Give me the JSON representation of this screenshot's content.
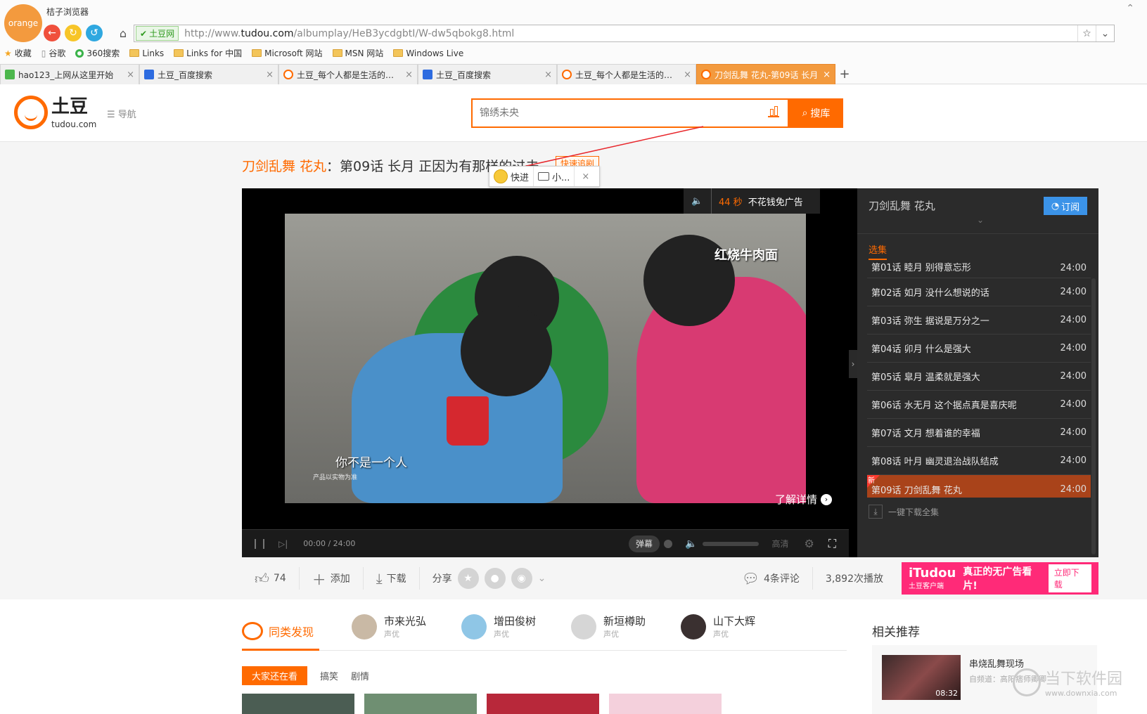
{
  "browser": {
    "logo_text": "orange",
    "app_name": "桔子浏览器",
    "address": {
      "site_badge": "土豆网",
      "url_prefix": "http://www.",
      "url_domain": "tudou.com",
      "url_path": "/albumplay/HeB3ycdgbtI/W-dw5qbokg8.html"
    },
    "bookmarks": [
      {
        "label": "收藏",
        "icon": "star-icon"
      },
      {
        "label": "谷歌",
        "icon": "page-icon"
      },
      {
        "label": "360搜索",
        "icon": "360-icon"
      },
      {
        "label": "Links",
        "icon": "folder-icon"
      },
      {
        "label": "Links for 中国",
        "icon": "folder-icon"
      },
      {
        "label": "Microsoft 网站",
        "icon": "folder-icon"
      },
      {
        "label": "MSN 网站",
        "icon": "folder-icon"
      },
      {
        "label": "Windows Live",
        "icon": "folder-icon"
      }
    ],
    "tabs": [
      {
        "label": "hao123_上网从这里开始",
        "icon": "hao123-icon"
      },
      {
        "label": "土豆_百度搜索",
        "icon": "baidu-icon"
      },
      {
        "label": "土豆_每个人都是生活的导演",
        "icon": "tudou-icon"
      },
      {
        "label": "土豆_百度搜索",
        "icon": "baidu-icon"
      },
      {
        "label": "土豆_每个人都是生活的导演",
        "icon": "tudou-icon"
      },
      {
        "label": "刀剑乱舞 花丸-第09话 长月",
        "icon": "tudou-icon",
        "active": true
      }
    ]
  },
  "site": {
    "brand": "土豆",
    "domain": "tudou.com",
    "nav_label": "导航",
    "search_placeholder": "锦绣未央",
    "search_button": "搜库"
  },
  "video": {
    "title_show": "刀剑乱舞 花丸",
    "title_rest": "：第09话 长月 正因为有那样的过去",
    "quick_tag": "快速追剧",
    "float_toolbar": {
      "fast": "快进",
      "mini": "小..."
    },
    "ad": {
      "seconds": "44 秒",
      "text": "不花钱免广告"
    },
    "frame_brand": "红烧牛肉面",
    "subtitle": "你不是一个人",
    "subnote": "产品以实物为准",
    "learn_more": "了解详情",
    "controls": {
      "time": "00:00 / 24:00",
      "danmu": "弹幕",
      "quality": "高清"
    }
  },
  "episodes": {
    "show": "刀剑乱舞 花丸",
    "subscribe": "订阅",
    "tab": "选集",
    "items": [
      {
        "label": "第01话 睦月 别得意忘形",
        "duration": "24:00"
      },
      {
        "label": "第02话 如月 没什么想说的话",
        "duration": "24:00"
      },
      {
        "label": "第03话 弥生 据说是万分之一",
        "duration": "24:00"
      },
      {
        "label": "第04话 卯月 什么是强大",
        "duration": "24:00"
      },
      {
        "label": "第05话 皐月 温柔就是强大",
        "duration": "24:00"
      },
      {
        "label": "第06话 水无月 这个据点真是喜庆呢",
        "duration": "24:00"
      },
      {
        "label": "第07话 文月 想着谁的幸福",
        "duration": "24:00"
      },
      {
        "label": "第08话 叶月 幽灵退治战队结成",
        "duration": "24:00"
      },
      {
        "label": "第09话 刀剑乱舞 花丸",
        "duration": "24:00",
        "current": true,
        "badge": "新"
      }
    ],
    "download_all": "一键下载全集"
  },
  "actions": {
    "likes": "74",
    "add": "添加",
    "download": "下载",
    "share": "分享",
    "comments": "4条评论",
    "plays": "3,892次播放",
    "itudou": {
      "brand": "iTudou",
      "sub": "土豆客户端",
      "slogan": "真正的无广告看片!",
      "button": "立即下载"
    }
  },
  "lower": {
    "similar": "同类发现",
    "voice_actors": [
      {
        "name": "市来光弘",
        "role": "声优"
      },
      {
        "name": "增田俊树",
        "role": "声优"
      },
      {
        "name": "新垣樽助",
        "role": "声优"
      },
      {
        "name": "山下大辉",
        "role": "声优"
      }
    ],
    "filters": [
      "大家还在看",
      "搞笑",
      "剧情"
    ],
    "related_title": "相关推荐",
    "related": {
      "title": "串烧乱舞现场",
      "from": "自频道：高阳痞师卿卿",
      "duration": "08:32"
    },
    "watermark": {
      "text": "当下软件园",
      "url": "www.downxia.com"
    }
  },
  "colors": {
    "accent": "#ff6a00",
    "browser_tab_active": "#f39a3e",
    "subscribe": "#3b93e8",
    "itudou": "#ff2a78"
  }
}
